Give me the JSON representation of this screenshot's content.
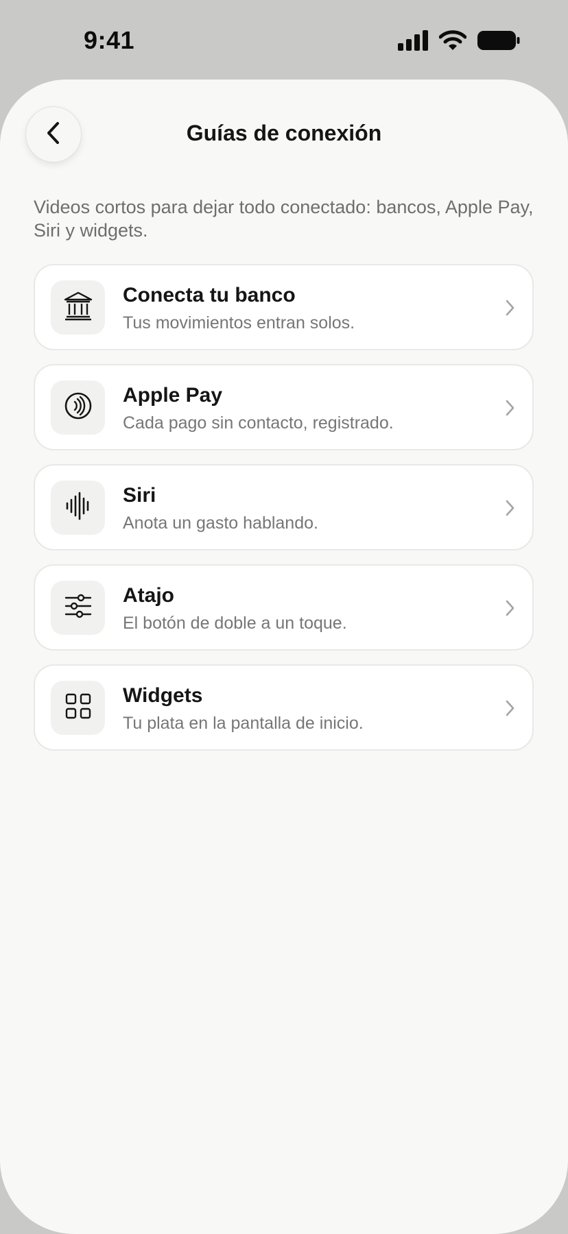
{
  "status_bar": {
    "time": "9:41",
    "icons": [
      "cellular-signal-icon",
      "wifi-icon",
      "battery-icon"
    ]
  },
  "header": {
    "title": "Guías de conexión",
    "back_icon": "chevron-left-icon"
  },
  "intro_text": "Videos cortos para dejar todo conectado: bancos, Apple Pay, Siri y widgets.",
  "guides": [
    {
      "title": "Conecta tu banco",
      "subtitle": "Tus movimientos entran solos.",
      "icon": "bank-icon"
    },
    {
      "title": "Apple Pay",
      "subtitle": "Cada pago sin contacto, registrado.",
      "icon": "contactless-icon"
    },
    {
      "title": "Siri",
      "subtitle": "Anota un gasto hablando.",
      "icon": "waveform-icon"
    },
    {
      "title": "Atajo",
      "subtitle": "El botón de doble a un toque.",
      "icon": "sliders-icon"
    },
    {
      "title": "Widgets",
      "subtitle": "Tu plata en la pantalla de inicio.",
      "icon": "grid-icon"
    }
  ],
  "colors": {
    "backdrop": "#c9c9c8",
    "sheet": "#f8f8f6",
    "card": "#ffffff",
    "icon_tile": "#f1f1ef",
    "text_primary": "#151515",
    "text_secondary": "#767676"
  }
}
